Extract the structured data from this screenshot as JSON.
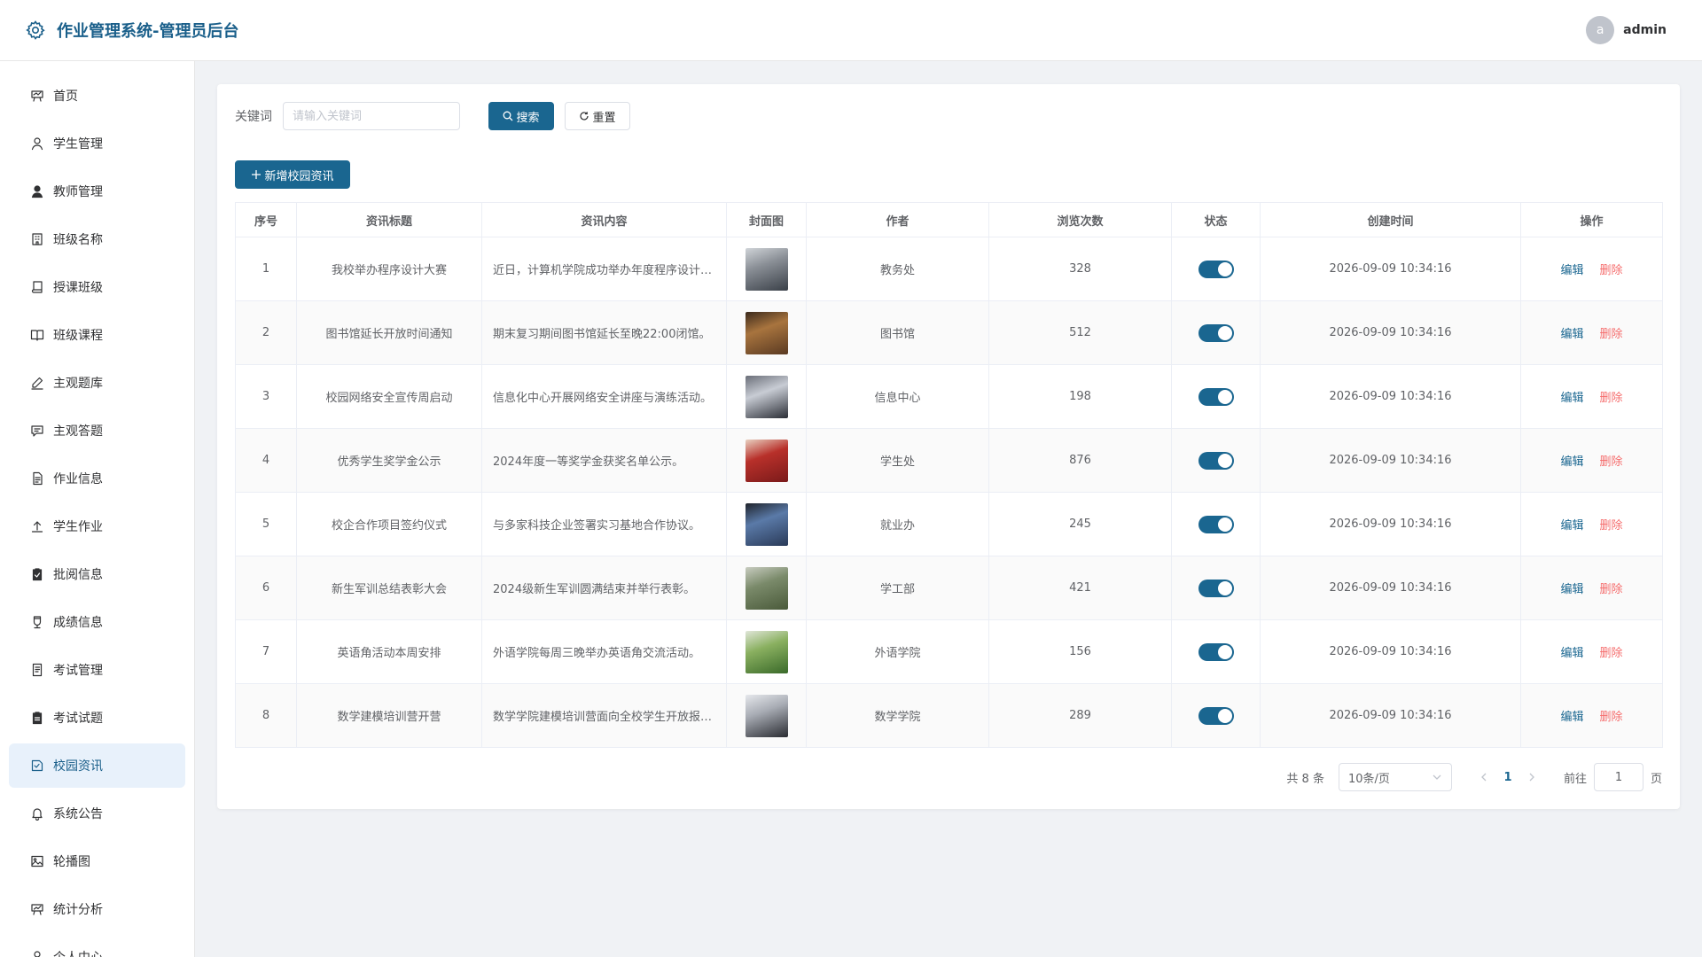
{
  "header": {
    "title": "作业管理系统-管理员后台",
    "avatar_letter": "a",
    "username": "admin",
    "brand_color": "#1a5f8a"
  },
  "sidebar": {
    "items": [
      {
        "label": "首页",
        "icon": "dashboard-icon"
      },
      {
        "label": "学生管理",
        "icon": "user-outline-icon"
      },
      {
        "label": "教师管理",
        "icon": "user-filled-icon"
      },
      {
        "label": "班级名称",
        "icon": "building-icon"
      },
      {
        "label": "授课班级",
        "icon": "book-icon"
      },
      {
        "label": "班级课程",
        "icon": "open-book-icon"
      },
      {
        "label": "主观题库",
        "icon": "edit-pen-icon"
      },
      {
        "label": "主观答题",
        "icon": "chat-icon"
      },
      {
        "label": "作业信息",
        "icon": "document-icon"
      },
      {
        "label": "学生作业",
        "icon": "upload-icon"
      },
      {
        "label": "批阅信息",
        "icon": "clipboard-check-icon"
      },
      {
        "label": "成绩信息",
        "icon": "cup-icon"
      },
      {
        "label": "考试管理",
        "icon": "notebook-icon"
      },
      {
        "label": "考试试题",
        "icon": "clipboard-icon"
      },
      {
        "label": "校园资讯",
        "icon": "news-icon",
        "active": true
      },
      {
        "label": "系统公告",
        "icon": "bell-icon"
      },
      {
        "label": "轮播图",
        "icon": "picture-icon"
      },
      {
        "label": "统计分析",
        "icon": "chart-icon"
      },
      {
        "label": "个人中心",
        "icon": "user-center-icon"
      }
    ]
  },
  "search": {
    "label": "关键词",
    "placeholder": "请输入关键词",
    "value": "",
    "search_button": "搜索",
    "reset_button": "重置"
  },
  "toolbar": {
    "add_button": "新增校园资讯"
  },
  "table": {
    "columns": [
      "序号",
      "资讯标题",
      "资讯内容",
      "封面图",
      "作者",
      "浏览次数",
      "状态",
      "创建时间",
      "操作"
    ],
    "edit_label": "编辑",
    "delete_label": "删除",
    "rows": [
      {
        "no": "1",
        "title": "我校举办程序设计大赛",
        "content": "近日，计算机学院成功举办年度程序设计大赛。",
        "thumb_colors": [
          "#3a4048",
          "#8a8f96",
          "#d0d4d8"
        ],
        "author": "教务处",
        "views": "328",
        "status_on": true,
        "created": "2026-09-09 10:34:16"
      },
      {
        "no": "2",
        "title": "图书馆延长开放时间通知",
        "content": "期末复习期间图书馆延长至晚22:00闭馆。",
        "thumb_colors": [
          "#5a3a22",
          "#a8743e",
          "#3b2a1c"
        ],
        "author": "图书馆",
        "views": "512",
        "status_on": true,
        "created": "2026-09-09 10:34:16"
      },
      {
        "no": "3",
        "title": "校园网络安全宣传周启动",
        "content": "信息化中心开展网络安全讲座与演练活动。",
        "thumb_colors": [
          "#2b2e36",
          "#c8ccd4",
          "#6a6e78"
        ],
        "author": "信息中心",
        "views": "198",
        "status_on": true,
        "created": "2026-09-09 10:34:16"
      },
      {
        "no": "4",
        "title": "优秀学生奖学金公示",
        "content": "2024年度一等奖学金获奖名单公示。",
        "thumb_colors": [
          "#7a1a1a",
          "#b8302a",
          "#e8d0c0"
        ],
        "author": "学生处",
        "views": "876",
        "status_on": true,
        "created": "2026-09-09 10:34:16"
      },
      {
        "no": "5",
        "title": "校企合作项目签约仪式",
        "content": "与多家科技企业签署实习基地合作协议。",
        "thumb_colors": [
          "#2a3a58",
          "#5a7aa8",
          "#20242c"
        ],
        "author": "就业办",
        "views": "245",
        "status_on": true,
        "created": "2026-09-09 10:34:16"
      },
      {
        "no": "6",
        "title": "新生军训总结表彰大会",
        "content": "2024级新生军训圆满结束并举行表彰。",
        "thumb_colors": [
          "#4a5a3a",
          "#7a8a6a",
          "#c8ccc0"
        ],
        "author": "学工部",
        "views": "421",
        "status_on": true,
        "created": "2026-09-09 10:34:16"
      },
      {
        "no": "7",
        "title": "英语角活动本周安排",
        "content": "外语学院每周三晚举办英语角交流活动。",
        "thumb_colors": [
          "#3a6a2a",
          "#8ab060",
          "#e0e6d8"
        ],
        "author": "外语学院",
        "views": "156",
        "status_on": true,
        "created": "2026-09-09 10:34:16"
      },
      {
        "no": "8",
        "title": "数学建模培训营开营",
        "content": "数学学院建模培训营面向全校学生开放报名。",
        "thumb_colors": [
          "#2a2c32",
          "#a8acb4",
          "#e6e8ec"
        ],
        "author": "数学学院",
        "views": "289",
        "status_on": true,
        "created": "2026-09-09 10:34:16"
      }
    ]
  },
  "pagination": {
    "total": "共 8 条",
    "page_size": "10条/页",
    "current_page": "1",
    "goto_prefix": "前往",
    "goto_value": "1",
    "goto_suffix": "页"
  }
}
